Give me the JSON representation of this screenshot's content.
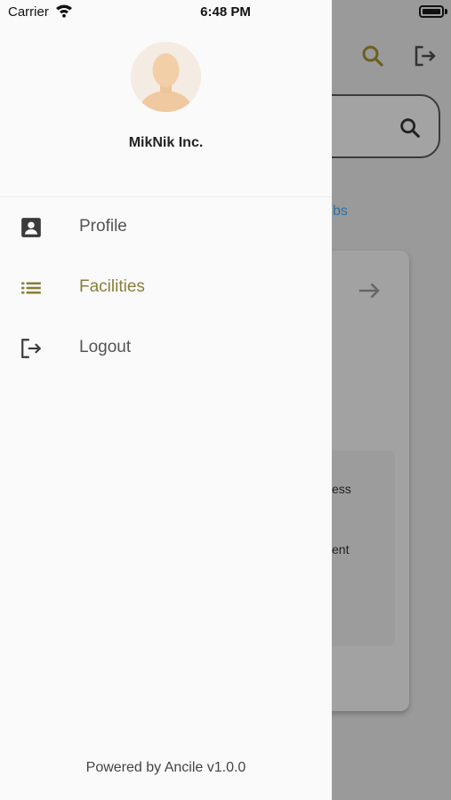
{
  "status_bar": {
    "carrier": "Carrier",
    "time": "6:48 PM"
  },
  "background": {
    "link_fragment": "bs",
    "card_text_1": "ess",
    "card_text_2": "ent"
  },
  "drawer": {
    "org_name": "MikNik Inc.",
    "menu": [
      {
        "label": "Profile",
        "icon": "contact-card-icon",
        "active": false
      },
      {
        "label": "Facilities",
        "icon": "list-icon",
        "active": true
      },
      {
        "label": "Logout",
        "icon": "logout-icon",
        "active": false
      }
    ],
    "footer": "Powered by Ancile v1.0.0"
  },
  "colors": {
    "accent": "#8a7d3a",
    "drawer_bg": "#fafafa",
    "scrim": "#9a9a9a"
  }
}
